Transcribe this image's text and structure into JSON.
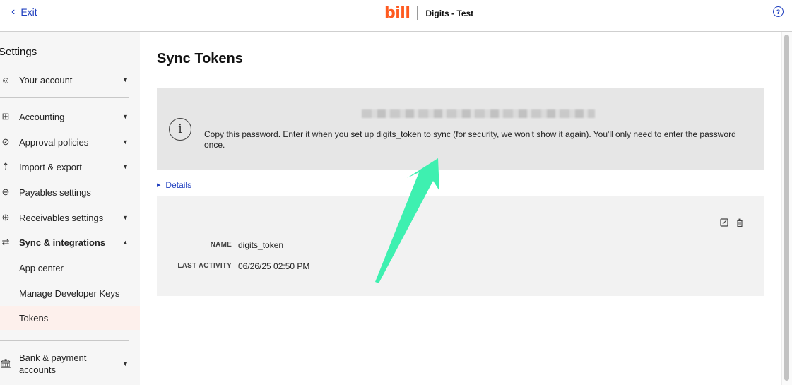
{
  "topbar": {
    "exit_label": "Exit",
    "logo_text": "bill",
    "company_name": "Digits - Test",
    "help_symbol": "?"
  },
  "sidebar": {
    "title": "Settings",
    "items": [
      {
        "label": "Your account",
        "icon": "account-icon",
        "caret": "▼"
      },
      {
        "label": "Accounting",
        "icon": "table-icon",
        "caret": "▼"
      },
      {
        "label": "Approval policies",
        "icon": "check-circle-icon",
        "caret": "▼"
      },
      {
        "label": "Import & export",
        "icon": "upload-icon",
        "caret": "▼"
      },
      {
        "label": "Payables settings",
        "icon": "arrow-out-circle-icon",
        "caret": ""
      },
      {
        "label": "Receivables settings",
        "icon": "arrow-in-circle-icon",
        "caret": "▼"
      },
      {
        "label": "Sync & integrations",
        "icon": "sync-icon",
        "caret": "▲"
      },
      {
        "label": "App center",
        "icon": "",
        "caret": ""
      },
      {
        "label": "Manage Developer Keys",
        "icon": "",
        "caret": ""
      },
      {
        "label": "Tokens",
        "icon": "",
        "caret": ""
      },
      {
        "label": "Bank & payment accounts",
        "icon": "bank-icon",
        "caret": "▼"
      }
    ],
    "active_item": "Tokens"
  },
  "main": {
    "title": "Sync Tokens",
    "info": {
      "message": "Copy this password. Enter it when you set up digits_token to sync (for security, we won't show it again). You'll only need to enter the password once."
    },
    "details_label": "Details",
    "token": {
      "name_label": "NAME",
      "name_value": "digits_token",
      "activity_label": "LAST ACTIVITY",
      "activity_value": "06/26/25 02:50 PM"
    }
  },
  "colors": {
    "accent": "#1f3fbf",
    "brand": "#ff5a1f",
    "annotation_arrow": "#3ef0b0",
    "active_bg": "#fdf0ec"
  }
}
